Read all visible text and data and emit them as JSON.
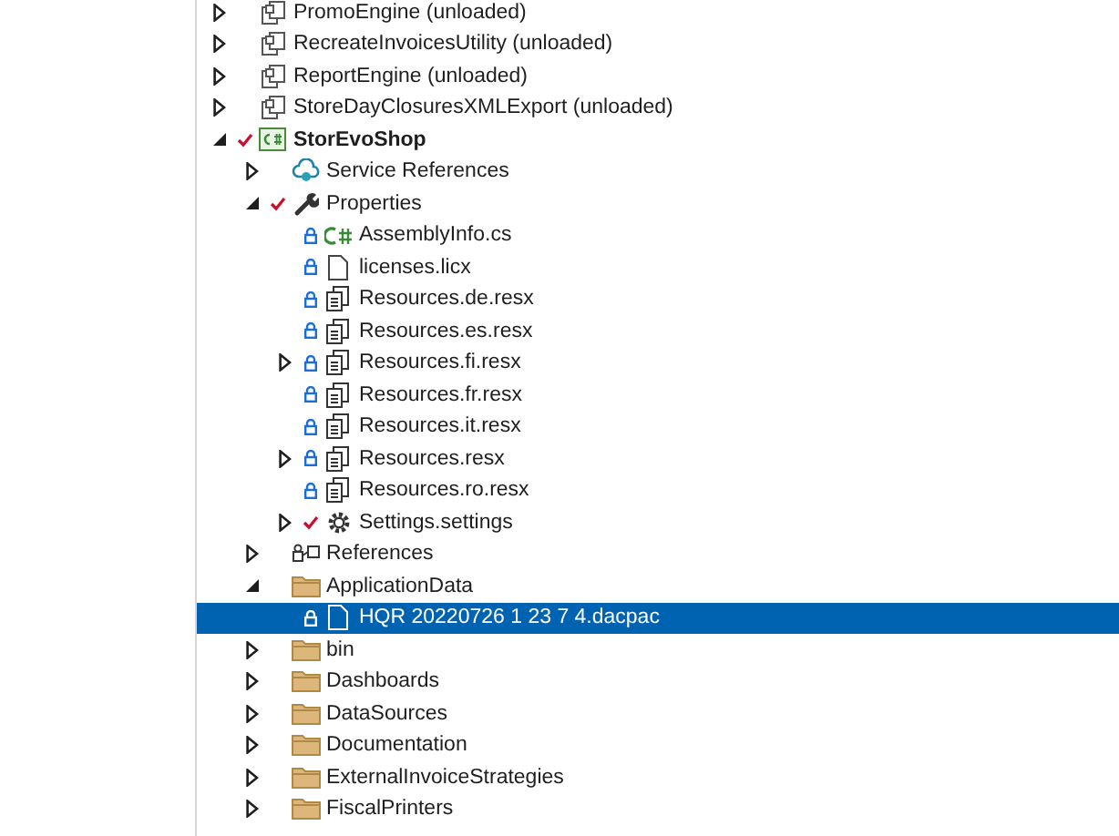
{
  "solution_tree": [
    {
      "label": "PromoEngine (unloaded)",
      "kind": "unloaded-project",
      "expanded": false,
      "modified": false,
      "locked": false,
      "selected": false
    },
    {
      "label": "RecreateInvoicesUtility (unloaded)",
      "kind": "unloaded-project",
      "expanded": false,
      "modified": false,
      "locked": false,
      "selected": false
    },
    {
      "label": "ReportEngine (unloaded)",
      "kind": "unloaded-project",
      "expanded": false,
      "modified": false,
      "locked": false,
      "selected": false
    },
    {
      "label": "StoreDayClosuresXMLExport (unloaded)",
      "kind": "unloaded-project",
      "expanded": false,
      "modified": false,
      "locked": false,
      "selected": false
    },
    {
      "label": "StorEvoShop",
      "kind": "project",
      "expanded": true,
      "modified": true,
      "locked": false,
      "selected": false,
      "children": [
        {
          "label": "Service References",
          "kind": "service-references",
          "expanded": false,
          "modified": false,
          "locked": false,
          "selected": false
        },
        {
          "label": "Properties",
          "kind": "properties",
          "expanded": true,
          "modified": true,
          "locked": false,
          "selected": false,
          "children": [
            {
              "label": "AssemblyInfo.cs",
              "kind": "csharp",
              "modified": false,
              "locked": true,
              "selected": false
            },
            {
              "label": "licenses.licx",
              "kind": "file",
              "modified": false,
              "locked": true,
              "selected": false
            },
            {
              "label": "Resources.de.resx",
              "kind": "resx",
              "modified": false,
              "locked": true,
              "selected": false
            },
            {
              "label": "Resources.es.resx",
              "kind": "resx",
              "modified": false,
              "locked": true,
              "selected": false
            },
            {
              "label": "Resources.fi.resx",
              "kind": "resx",
              "expanded": false,
              "modified": false,
              "locked": true,
              "selected": false
            },
            {
              "label": "Resources.fr.resx",
              "kind": "resx",
              "modified": false,
              "locked": true,
              "selected": false
            },
            {
              "label": "Resources.it.resx",
              "kind": "resx",
              "modified": false,
              "locked": true,
              "selected": false
            },
            {
              "label": "Resources.resx",
              "kind": "resx",
              "expanded": false,
              "modified": false,
              "locked": true,
              "selected": false
            },
            {
              "label": "Resources.ro.resx",
              "kind": "resx",
              "modified": false,
              "locked": true,
              "selected": false
            },
            {
              "label": "Settings.settings",
              "kind": "settings",
              "expanded": false,
              "modified": true,
              "locked": false,
              "selected": false
            }
          ]
        },
        {
          "label": "References",
          "kind": "references",
          "expanded": false,
          "modified": false,
          "locked": false,
          "selected": false
        },
        {
          "label": "ApplicationData",
          "kind": "folder",
          "expanded": true,
          "modified": false,
          "locked": false,
          "selected": false,
          "children": [
            {
              "label": "HQR 20220726 1 23 7 4.dacpac",
              "kind": "file",
              "modified": false,
              "locked": true,
              "selected": true
            }
          ]
        },
        {
          "label": "bin",
          "kind": "folder",
          "expanded": false,
          "modified": false,
          "locked": false,
          "selected": false
        },
        {
          "label": "Dashboards",
          "kind": "folder",
          "expanded": false,
          "modified": false,
          "locked": false,
          "selected": false
        },
        {
          "label": "DataSources",
          "kind": "folder",
          "expanded": false,
          "modified": false,
          "locked": false,
          "selected": false
        },
        {
          "label": "Documentation",
          "kind": "folder",
          "expanded": false,
          "modified": false,
          "locked": false,
          "selected": false
        },
        {
          "label": "ExternalInvoiceStrategies",
          "kind": "folder",
          "expanded": false,
          "modified": false,
          "locked": false,
          "selected": false
        },
        {
          "label": "FiscalPrinters",
          "kind": "folder",
          "expanded": false,
          "modified": false,
          "locked": false,
          "selected": false
        }
      ]
    }
  ]
}
